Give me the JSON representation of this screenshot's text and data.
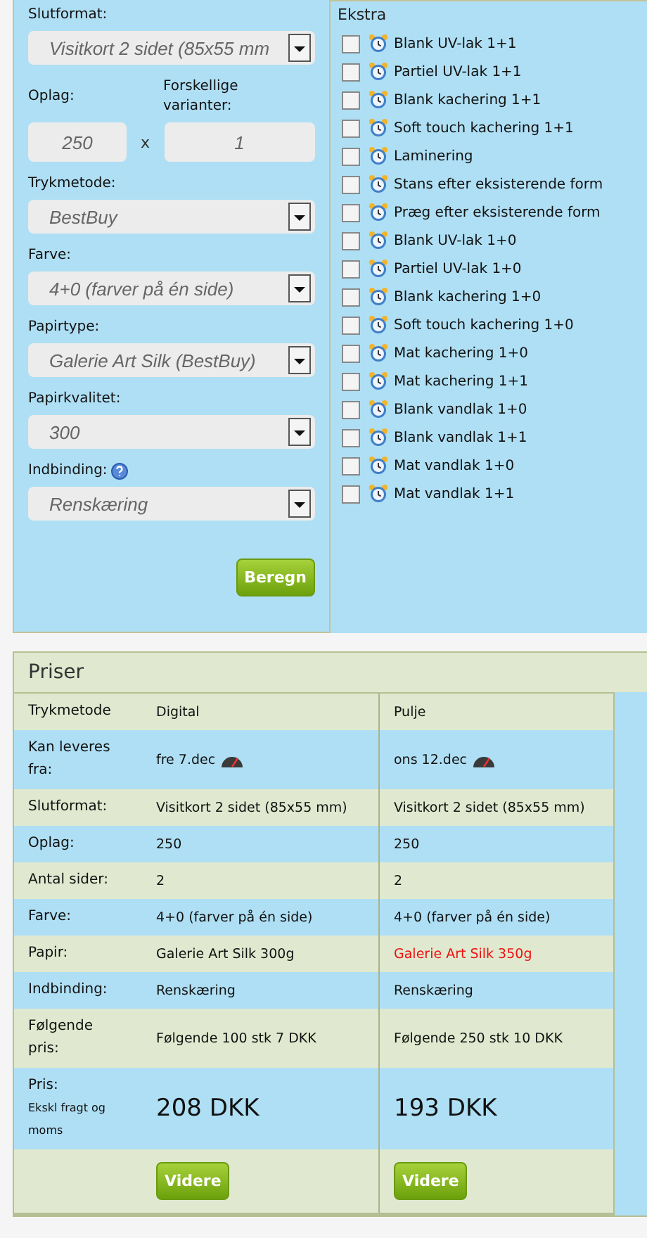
{
  "form": {
    "fields": [
      {
        "kind": "select",
        "label": "Slutformat:",
        "value": "Visitkort 2 sidet (85x55 mm",
        "help": false
      },
      {
        "kind": "pair",
        "label": "Oplag:",
        "label_2": "Forskellige varianter:",
        "value": "250",
        "separator": "x",
        "value_2": "1"
      },
      {
        "kind": "select",
        "label": "Trykmetode:",
        "value": "BestBuy",
        "help": false
      },
      {
        "kind": "select",
        "label": "Farve:",
        "value": "4+0 (farver på én side)",
        "help": false
      },
      {
        "kind": "select",
        "label": "Papirtype:",
        "value": "Galerie Art Silk (BestBuy)",
        "help": false
      },
      {
        "kind": "select",
        "label": "Papirkvalitet:",
        "value": "300",
        "help": false
      },
      {
        "kind": "select",
        "label": "Indbinding:",
        "value": "Renskæring",
        "help": true
      }
    ],
    "button": "Beregn"
  },
  "extras": {
    "title": "Ekstra",
    "items": [
      {
        "label": "Blank UV-lak 1+1",
        "checked": false
      },
      {
        "label": "Partiel UV-lak 1+1",
        "checked": false
      },
      {
        "label": "Blank kachering 1+1",
        "checked": false
      },
      {
        "label": "Soft touch kachering 1+1",
        "checked": false
      },
      {
        "label": "Laminering",
        "checked": false
      },
      {
        "label": "Stans efter eksisterende form",
        "checked": false
      },
      {
        "label": "Præg efter eksisterende form",
        "checked": false
      },
      {
        "label": "Blank UV-lak 1+0",
        "checked": false
      },
      {
        "label": "Partiel UV-lak 1+0",
        "checked": false
      },
      {
        "label": "Blank kachering 1+0",
        "checked": false
      },
      {
        "label": "Soft touch kachering 1+0",
        "checked": false
      },
      {
        "label": "Mat kachering 1+0",
        "checked": false
      },
      {
        "label": "Mat kachering 1+1",
        "checked": false
      },
      {
        "label": "Blank vandlak 1+0",
        "checked": false
      },
      {
        "label": "Blank vandlak 1+1",
        "checked": false
      },
      {
        "label": "Mat vandlak 1+0",
        "checked": false
      },
      {
        "label": "Mat vandlak 1+1",
        "checked": false
      }
    ]
  },
  "prices": {
    "title": "Priser",
    "rows": [
      {
        "kind": "header",
        "label": "Trykmetode",
        "cells": [
          {
            "text": "Digital",
            "alert": false
          },
          {
            "text": "Pulje",
            "alert": false
          }
        ]
      },
      {
        "kind": "delivery",
        "label": "Kan leveres fra:",
        "cells": [
          {
            "text": "fre 7.dec",
            "alert": false
          },
          {
            "text": "ons 12.dec",
            "alert": false
          }
        ]
      },
      {
        "kind": "text",
        "label": "Slutformat:",
        "cells": [
          {
            "text": "Visitkort 2 sidet (85x55 mm)",
            "alert": false
          },
          {
            "text": "Visitkort 2 sidet (85x55 mm)",
            "alert": false
          }
        ]
      },
      {
        "kind": "text",
        "label": "Oplag:",
        "cells": [
          {
            "text": "250",
            "alert": false
          },
          {
            "text": "250",
            "alert": false
          }
        ]
      },
      {
        "kind": "text",
        "label": "Antal sider:",
        "cells": [
          {
            "text": "2",
            "alert": false
          },
          {
            "text": "2",
            "alert": false
          }
        ]
      },
      {
        "kind": "text",
        "label": "Farve:",
        "cells": [
          {
            "text": "4+0 (farver på én side)",
            "alert": false
          },
          {
            "text": "4+0 (farver på én side)",
            "alert": false
          }
        ]
      },
      {
        "kind": "text",
        "label": "Papir:",
        "cells": [
          {
            "text": "Galerie Art Silk 300g",
            "alert": false
          },
          {
            "text": "Galerie Art Silk 350g",
            "alert": true
          }
        ]
      },
      {
        "kind": "text",
        "label": "Indbinding:",
        "cells": [
          {
            "text": "Renskæring",
            "alert": false
          },
          {
            "text": "Renskæring",
            "alert": false
          }
        ]
      },
      {
        "kind": "text",
        "label": "Følgende pris:",
        "cells": [
          {
            "text": "Følgende 100 stk 7 DKK",
            "alert": false
          },
          {
            "text": "Følgende 250 stk 10 DKK",
            "alert": false
          }
        ]
      },
      {
        "kind": "price",
        "label": "Pris:",
        "note": "Ekskl fragt og moms",
        "cells": [
          {
            "text": "208 DKK",
            "alert": false
          },
          {
            "text": "193 DKK",
            "alert": false
          }
        ]
      },
      {
        "kind": "buttons",
        "cells": [
          {
            "text": "Videre",
            "alert": false
          },
          {
            "text": "Videre",
            "alert": false
          }
        ]
      }
    ]
  }
}
